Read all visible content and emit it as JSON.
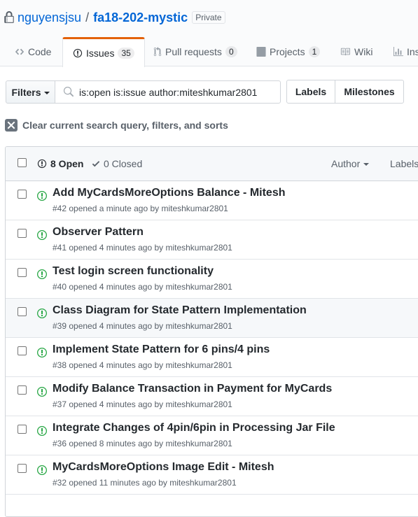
{
  "repo": {
    "owner": "nguyensjsu",
    "separator": "/",
    "name": "fa18-202-mystic",
    "visibility": "Private"
  },
  "tabs": [
    {
      "label": "Code",
      "icon": "code-icon",
      "count": null
    },
    {
      "label": "Issues",
      "icon": "issue-opened-icon",
      "count": "35"
    },
    {
      "label": "Pull requests",
      "icon": "git-pull-request-icon",
      "count": "0"
    },
    {
      "label": "Projects",
      "icon": "project-icon",
      "count": "1"
    },
    {
      "label": "Wiki",
      "icon": "book-icon",
      "count": null
    },
    {
      "label": "Ins",
      "icon": "graph-icon",
      "count": null
    }
  ],
  "filters": {
    "button_label": "Filters",
    "search_value": "is:open is:issue author:miteshkumar2801"
  },
  "buttons": {
    "labels": "Labels",
    "milestones": "Milestones"
  },
  "clear_filters": "Clear current search query, filters, and sorts",
  "issues_header": {
    "open": "8 Open",
    "closed": "0 Closed",
    "author": "Author",
    "labels": "Labels"
  },
  "issues": [
    {
      "title": "Add MyCardsMoreOptions Balance - Mitesh",
      "meta": "#42 opened a minute ago by miteshkumar2801"
    },
    {
      "title": "Observer Pattern",
      "meta": "#41 opened 4 minutes ago by miteshkumar2801"
    },
    {
      "title": "Test login screen functionality",
      "meta": "#40 opened 4 minutes ago by miteshkumar2801"
    },
    {
      "title": "Class Diagram for State Pattern Implementation",
      "meta": "#39 opened 4 minutes ago by miteshkumar2801"
    },
    {
      "title": "Implement State Pattern for 6 pins/4 pins",
      "meta": "#38 opened 4 minutes ago by miteshkumar2801"
    },
    {
      "title": "Modify Balance Transaction in Payment for MyCards",
      "meta": "#37 opened 4 minutes ago by miteshkumar2801"
    },
    {
      "title": "Integrate Changes of 4pin/6pin in Processing Jar File",
      "meta": "#36 opened 8 minutes ago by miteshkumar2801"
    },
    {
      "title": "MyCardsMoreOptions Image Edit - Mitesh",
      "meta": "#32 opened 11 minutes ago by miteshkumar2801"
    }
  ],
  "colors": {
    "link": "#0366d6",
    "open_green": "#28a745",
    "tab_accent": "#e36209",
    "muted": "#586069"
  }
}
